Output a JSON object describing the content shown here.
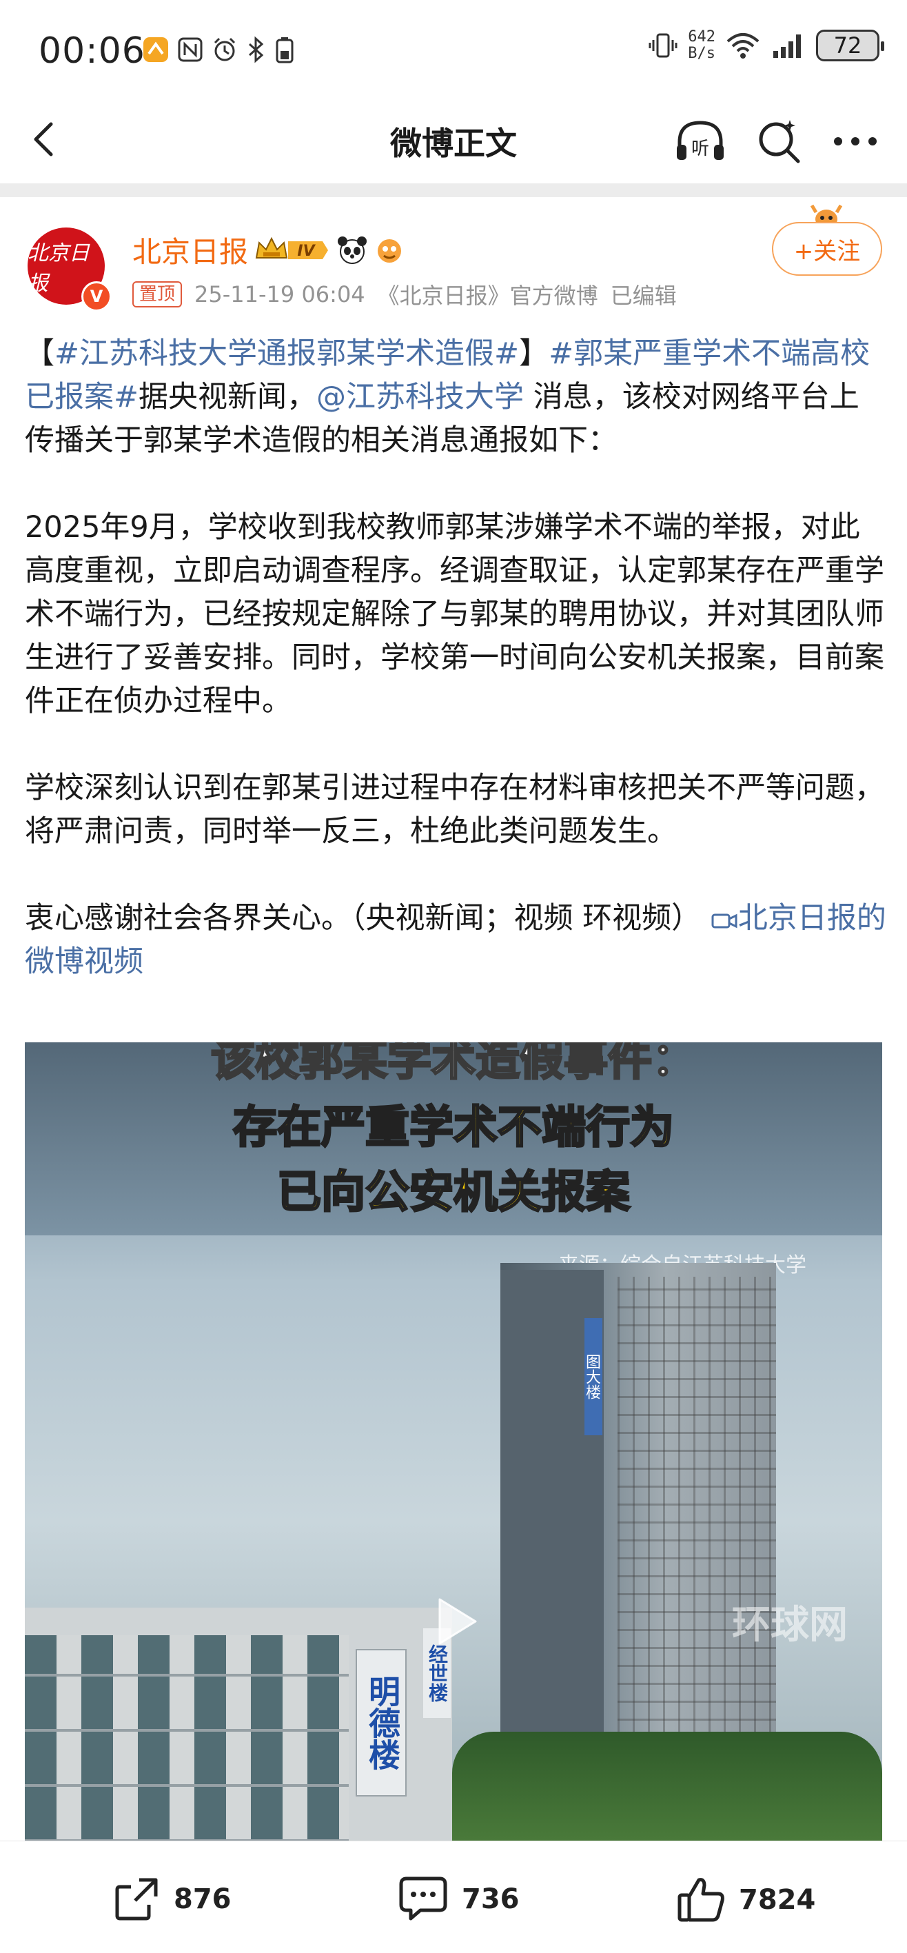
{
  "status_bar": {
    "time": "00:06",
    "net_speed_value": "642",
    "net_speed_unit": "B/s",
    "battery": "72"
  },
  "nav": {
    "title": "微博正文"
  },
  "post": {
    "author": "北京日报",
    "avatar_text": "北京日报",
    "verified_mark": "V",
    "level": "IV",
    "pin_label": "置顶",
    "timestamp": "25-11-19 06:04",
    "source": "《北京日报》官方微博",
    "edited": "已编辑",
    "follow_label": "+关注",
    "p1": {
      "bracket_open": "【",
      "tag1": "#江苏科技大学通报郭某学术造假#",
      "bracket_close": "】",
      "tag2": "#郭某严重学术不端高校已报案#",
      "text_a": "据央视新闻，",
      "mention": "@江苏科技大学",
      "text_b": " 消息，该校对网络平台上传播关于郭某学术造假的相关消息通报如下："
    },
    "p2": "2025年9月，学校收到我校教师郭某涉嫌学术不端的举报，对此高度重视，立即启动调查程序。经调查取证，认定郭某存在严重学术不端行为，已经按规定解除了与郭某的聘用协议，并对其团队师生进行了妥善安排。同时，学校第一时间向公安机关报案，目前案件正在侦办过程中。",
    "p3": "学校深刻认识到在郭某引进过程中存在材料审核把关不严等问题，将严肃问责，同时举一反三，杜绝此类问题发生。",
    "p4_text": "衷心感谢社会各界关心。（央视新闻；视频 环视频） ",
    "p4_link": "北京日报的微博视频",
    "video": {
      "line1": "该校郭某学术造假事件：",
      "line2": "存在严重学术不端行为",
      "line3": "已向公安机关报案",
      "source": "来源：综合自江苏科技大学",
      "building_sign_left": "明德楼",
      "building_sign_right": "经世楼",
      "tower_sign": "图大楼",
      "watermark": "环球网"
    }
  },
  "actions": {
    "repost_count": "876",
    "comment_count": "736",
    "like_count": "7824"
  }
}
